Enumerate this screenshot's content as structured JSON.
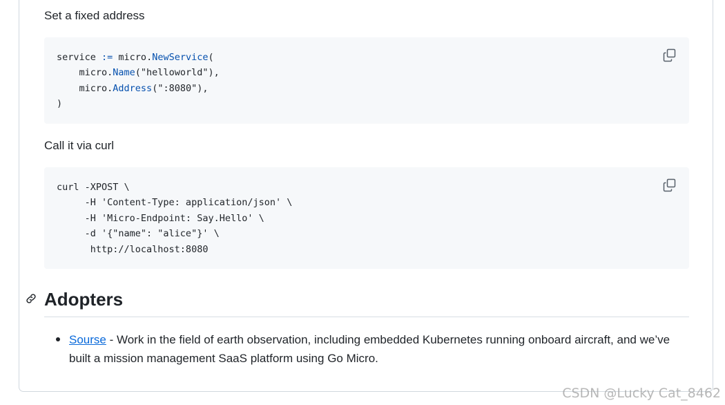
{
  "section1": {
    "text": "Set a fixed address",
    "code": {
      "line1_a": "service ",
      "line1_op": ":=",
      "line1_b": " micro.",
      "line1_fn": "NewService",
      "line1_c": "(",
      "line2_a": "    micro.",
      "line2_fn": "Name",
      "line2_b": "(\"helloworld\"),",
      "line3_a": "    micro.",
      "line3_fn": "Address",
      "line3_b": "(\":8080\"),",
      "line4": ")"
    }
  },
  "section2": {
    "text": "Call it via curl",
    "code_lines": [
      "curl -XPOST \\",
      "     -H 'Content-Type: application/json' \\",
      "     -H 'Micro-Endpoint: Say.Hello' \\",
      "     -d '{\"name\": \"alice\"}' \\",
      "      http://localhost:8080"
    ]
  },
  "adopters": {
    "heading": "Adopters",
    "items": [
      {
        "link": "Sourse",
        "text": " - Work in the field of earth observation, including embedded Kubernetes running onboard aircraft, and we’ve built a mission management SaaS platform using Go Micro."
      }
    ]
  },
  "watermark": "CSDN @Lucky Cat_8462",
  "colors": {
    "code_bg": "#f6f8fa",
    "fn": "#0550ae",
    "link": "#0969da",
    "text": "#1f2328"
  },
  "icons": {
    "copy": "copy-icon",
    "anchor": "link-icon"
  }
}
